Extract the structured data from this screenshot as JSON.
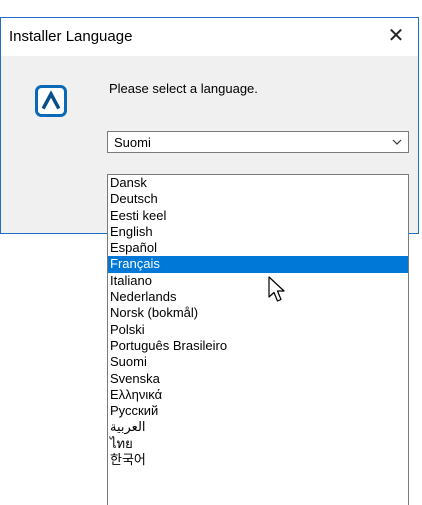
{
  "window": {
    "title": "Installer Language",
    "close_glyph": "✕"
  },
  "prompt": "Please select a language.",
  "icon": "installer-app-icon",
  "colors": {
    "accent": "#0078d7",
    "window_border": "#1f6fc5",
    "client_bg": "#f0f0f0",
    "icon_stroke": "#0a6ab8"
  },
  "language_select": {
    "selected_value": "Suomi",
    "expanded": true,
    "highlighted": "Français",
    "options": [
      "Dansk",
      "Deutsch",
      "Eesti keel",
      "English",
      "Español",
      "Français",
      "Italiano",
      "Nederlands",
      "Norsk (bokmål)",
      "Polski",
      "Português Brasileiro",
      "Suomi",
      "Svenska",
      "Ελληνικά",
      "Русский",
      "العربية",
      "ไทย",
      "한국어"
    ]
  }
}
